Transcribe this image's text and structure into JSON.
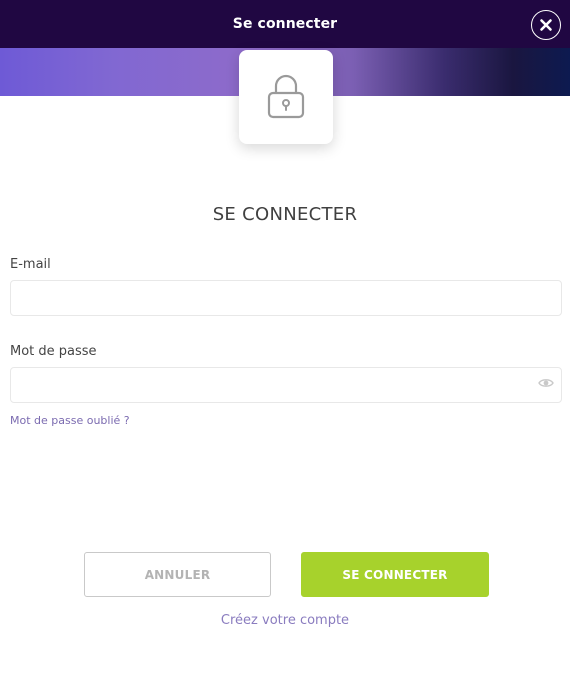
{
  "header": {
    "title": "Se connecter",
    "close_icon": "close-icon"
  },
  "banner": {
    "lock_icon": "lock-icon"
  },
  "form": {
    "heading": "SE CONNECTER",
    "email_label": "E-mail",
    "email_value": "",
    "email_placeholder": "",
    "password_label": "Mot de passe",
    "password_value": "",
    "password_placeholder": "",
    "password_toggle_icon": "eye-icon",
    "forgot_password": "Mot de passe oublié ?"
  },
  "actions": {
    "cancel_label": "ANNULER",
    "login_label": "SE CONNECTER",
    "create_account": "Créez votre compte"
  },
  "colors": {
    "header_bg": "#200742",
    "accent_green": "#a7d22c",
    "link_purple": "#8a7cbf"
  }
}
